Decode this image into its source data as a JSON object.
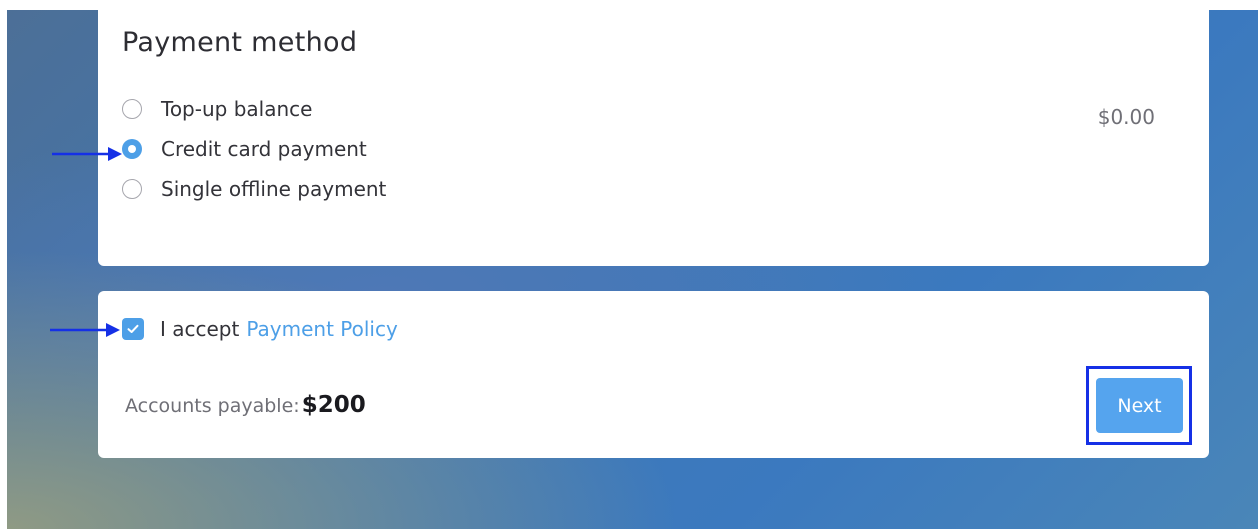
{
  "payment_method": {
    "title": "Payment method",
    "options": [
      {
        "label": "Top-up balance",
        "selected": false,
        "value": "$0.00"
      },
      {
        "label": "Credit card payment",
        "selected": true
      },
      {
        "label": "Single offline payment",
        "selected": false
      }
    ]
  },
  "confirmation": {
    "accept_text": "I accept",
    "policy_link": "Payment Policy",
    "accepted": true,
    "payable_label": "Accounts payable:",
    "payable_amount": "$200",
    "next_label": "Next"
  },
  "colors": {
    "accent": "#4d9fe7",
    "annotation": "#1530e6",
    "button": "#55a4ee"
  },
  "icons": [
    "radio-button-icon",
    "checkmark-icon",
    "arrow-right-icon"
  ]
}
